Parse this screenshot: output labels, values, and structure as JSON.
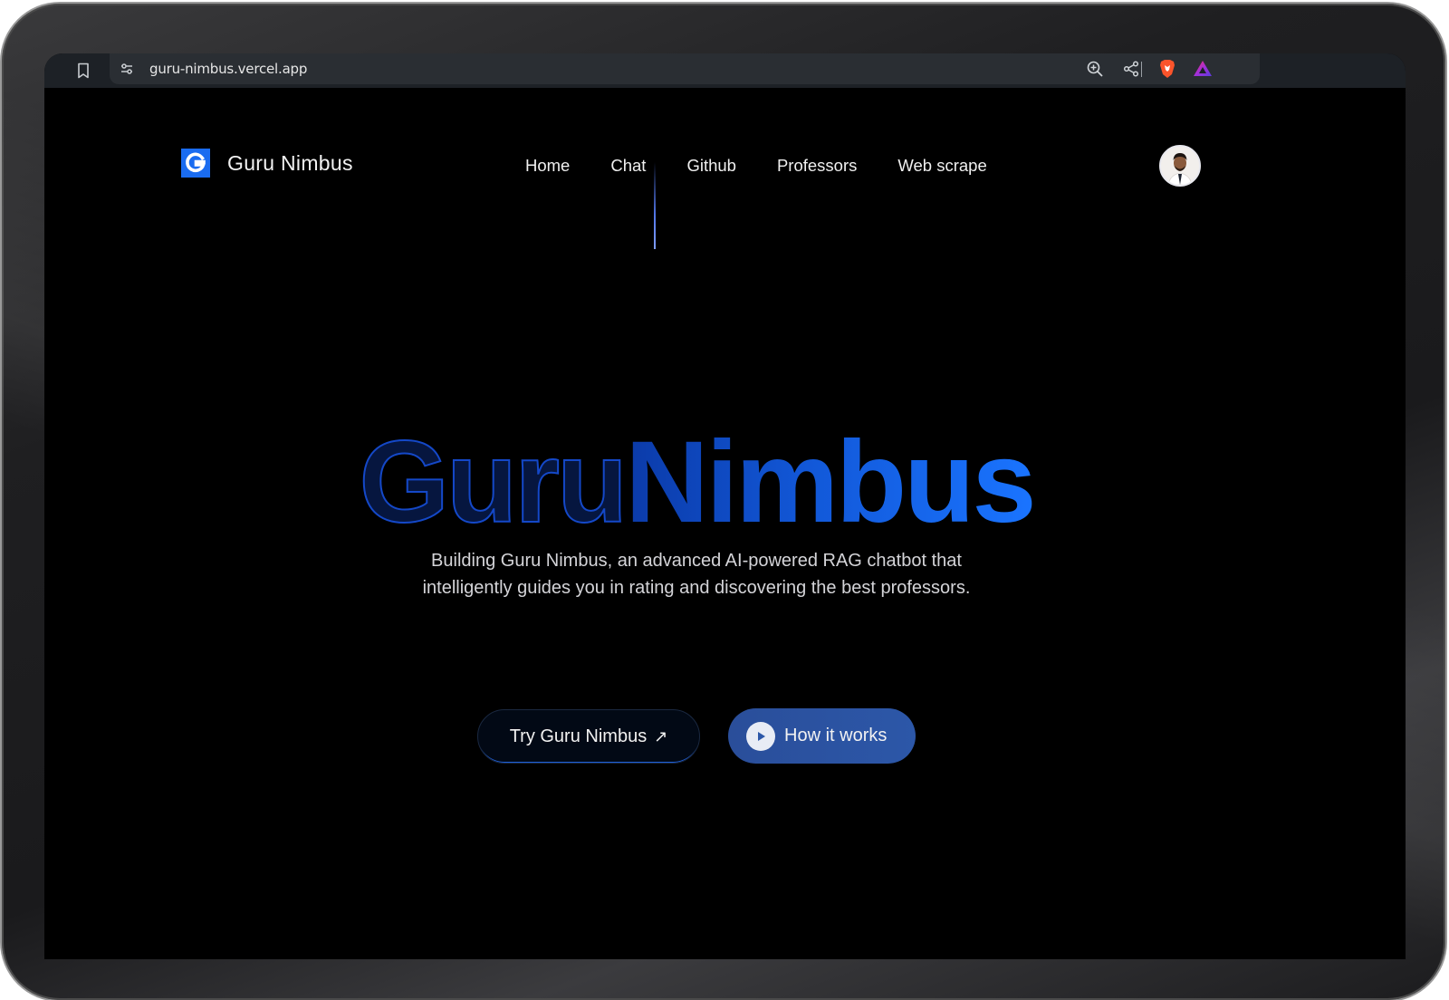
{
  "browser": {
    "url": "guru-nimbus.vercel.app",
    "icons": [
      "bookmark-icon",
      "site-settings-icon",
      "zoom-icon",
      "share-icon",
      "brave-shield-icon",
      "brave-rewards-icon"
    ]
  },
  "site": {
    "logo_letter": "G",
    "brand": "Guru Nimbus",
    "nav": [
      "Home",
      "Chat",
      "Github",
      "Professors",
      "Web scrape"
    ],
    "accent": "#1a6cf0"
  },
  "hero": {
    "title_part1": "Guru",
    "title_part2": "Nimbus",
    "subtitle": "Building Guru Nimbus, an advanced AI-powered RAG chatbot that intelligently guides you in rating and discovering the best professors.",
    "primary_button": "Try Guru Nimbus",
    "primary_button_icon": "↗",
    "secondary_button": "How it works",
    "secondary_button_icon": "play-icon"
  }
}
